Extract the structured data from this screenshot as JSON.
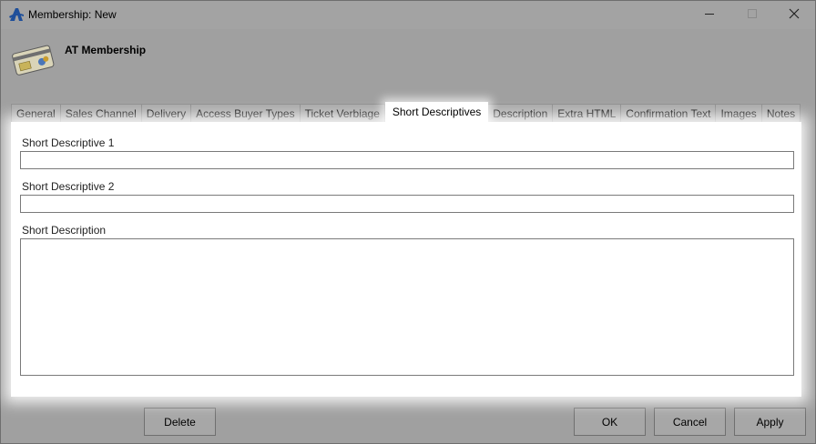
{
  "window": {
    "title": "Membership: New",
    "controls": {
      "minimize_icon": "minimize-icon",
      "maximize_icon": "maximize-icon",
      "close_icon": "close-icon"
    }
  },
  "header": {
    "title": "AT Membership",
    "icon": "membership-card-icon"
  },
  "tabs": [
    {
      "label": "General"
    },
    {
      "label": "Sales Channel"
    },
    {
      "label": "Delivery"
    },
    {
      "label": "Access Buyer Types"
    },
    {
      "label": "Ticket Verbiage"
    },
    {
      "label": "Short Descriptives",
      "active": true
    },
    {
      "label": "Description"
    },
    {
      "label": "Extra HTML"
    },
    {
      "label": "Confirmation Text"
    },
    {
      "label": "Images"
    },
    {
      "label": "Notes"
    }
  ],
  "form": {
    "short_descriptive_1": {
      "label": "Short Descriptive 1",
      "value": ""
    },
    "short_descriptive_2": {
      "label": "Short Descriptive 2",
      "value": ""
    },
    "short_description": {
      "label": "Short Description",
      "value": ""
    }
  },
  "footer": {
    "delete_label": "Delete",
    "ok_label": "OK",
    "cancel_label": "Cancel",
    "apply_label": "Apply"
  },
  "colors": {
    "window_bg": "#a0a0a0",
    "panel_bg": "#ffffff",
    "logo_blue": "#1f4f9a"
  }
}
